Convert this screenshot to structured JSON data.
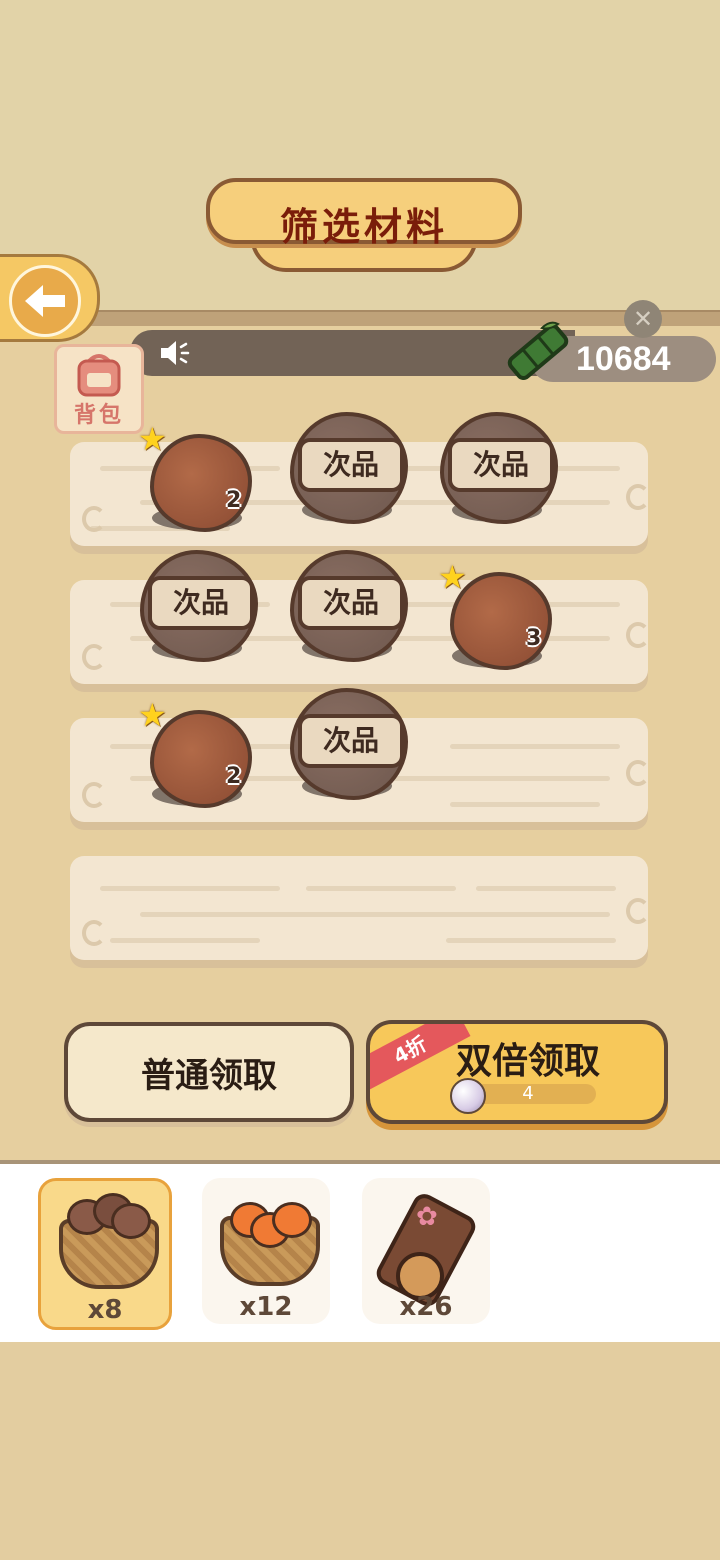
{
  "header": {
    "title": "筛选材料"
  },
  "currency": {
    "value": "10684",
    "icon": "bamboo-icon"
  },
  "backpack": {
    "label": "背包"
  },
  "shelves": [
    {
      "items": [
        {
          "type": "good",
          "count": "2"
        },
        {
          "type": "defect",
          "label": "次品"
        },
        {
          "type": "defect",
          "label": "次品"
        }
      ]
    },
    {
      "items": [
        {
          "type": "defect",
          "label": "次品"
        },
        {
          "type": "defect",
          "label": "次品"
        },
        {
          "type": "good",
          "count": "3"
        }
      ]
    },
    {
      "items": [
        {
          "type": "good",
          "count": "2"
        },
        {
          "type": "defect",
          "label": "次品"
        }
      ]
    },
    {
      "items": []
    }
  ],
  "actions": {
    "normal_label": "普通领取",
    "double_label": "双倍领取",
    "discount_badge": "4折",
    "cost": "4"
  },
  "inventory": [
    {
      "name": "potato-basket",
      "count": "x8",
      "selected": true
    },
    {
      "name": "carrot-basket",
      "count": "x12",
      "selected": false
    },
    {
      "name": "wood-log",
      "count": "x26",
      "selected": false
    }
  ]
}
